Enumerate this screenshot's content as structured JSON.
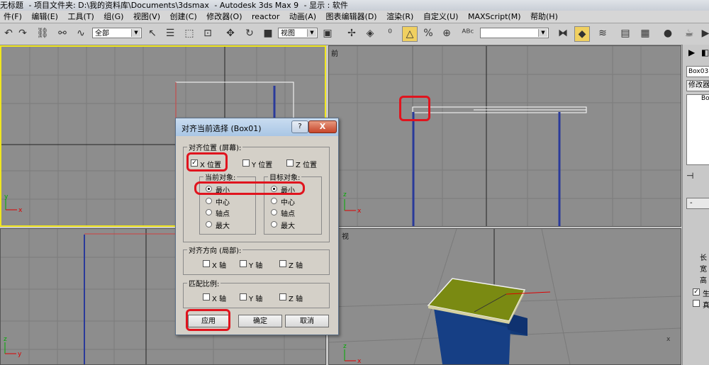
{
  "titlebar": {
    "doc": "无标题",
    "project": "- 项目文件夹: D:\\我的资料库\\Documents\\3dsmax",
    "app": "- Autodesk 3ds Max 9",
    "display": "- 显示 : 软件"
  },
  "menu": [
    "件(F)",
    "编辑(E)",
    "工具(T)",
    "组(G)",
    "视图(V)",
    "创建(C)",
    "修改器(O)",
    "reactor",
    "动画(A)",
    "图表编辑器(D)",
    "渲染(R)",
    "自定义(U)",
    "MAXScript(M)",
    "帮助(H)"
  ],
  "toolbar": {
    "selection_filter": "全部",
    "coord_system": "视图",
    "named_selection": ""
  },
  "viewports": {
    "front_label": "前",
    "persp_label": "视"
  },
  "right_panel": {
    "object_name": "Box03",
    "modifier_label": "修改器",
    "stack_item": "Bo",
    "rollout_label": "-",
    "param_1": "长",
    "param_2": "宽",
    "param_3": "高",
    "check_1": "生",
    "check_2": "真"
  },
  "dialog": {
    "title": "对齐当前选择 (Box01)",
    "help": "?",
    "close": "X",
    "align_position_group": "对齐位置 (屏幕):",
    "x_pos": "X 位置",
    "y_pos": "Y 位置",
    "z_pos": "Z 位置",
    "current_object_group": "当前对象:",
    "target_object_group": "目标对象:",
    "opt_min": "最小",
    "opt_center": "中心",
    "opt_pivot": "轴点",
    "opt_max": "最大",
    "orientation_group": "对齐方向 (局部):",
    "scale_group": "匹配比例:",
    "x_axis": "X 轴",
    "y_axis": "Y 轴",
    "z_axis": "Z 轴",
    "apply": "应用",
    "ok": "确定",
    "cancel": "取消",
    "state": {
      "x_pos_checked": true,
      "y_pos_checked": false,
      "z_pos_checked": false,
      "current_object": "最小",
      "target_object": "最小"
    }
  },
  "colors": {
    "viewport_bg": "#8d8d8d",
    "active_border": "#f0e61e",
    "annotation_red": "#e0141e",
    "box_top": "#7a8a12",
    "box_side": "#123a78"
  }
}
